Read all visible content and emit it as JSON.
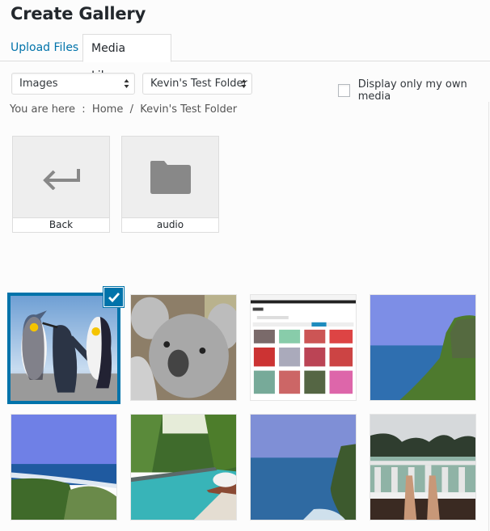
{
  "header": {
    "title": "Create Gallery"
  },
  "tabs": [
    {
      "label": "Upload Files",
      "active": false
    },
    {
      "label": "Media Library",
      "active": true
    }
  ],
  "filters": {
    "type_select": {
      "value": "Images"
    },
    "folder_select": {
      "value": "Kevin's Test Folder"
    },
    "own_media": {
      "label": "Display only my own media",
      "checked": false
    }
  },
  "breadcrumb": {
    "prefix": "You are here",
    "separator": ":",
    "items": [
      "Home",
      "Kevin's Test Folder"
    ],
    "divider": "/"
  },
  "folders": [
    {
      "label": "Back",
      "icon": "back-arrow-icon"
    },
    {
      "label": "audio",
      "icon": "folder-icon"
    }
  ],
  "media": [
    {
      "subject": "penguins",
      "selected": true
    },
    {
      "subject": "koala",
      "selected": false
    },
    {
      "subject": "media-library-screenshot",
      "selected": false
    },
    {
      "subject": "sea-cliff",
      "selected": false
    },
    {
      "subject": "ocean-coast",
      "selected": false
    },
    {
      "subject": "pool-garden",
      "selected": false
    },
    {
      "subject": "cliff-ocean",
      "selected": false
    },
    {
      "subject": "boat-deck-feet",
      "selected": false
    }
  ],
  "colors": {
    "accent": "#0073aa",
    "link": "#0073aa",
    "icon_gray": "#888888"
  }
}
